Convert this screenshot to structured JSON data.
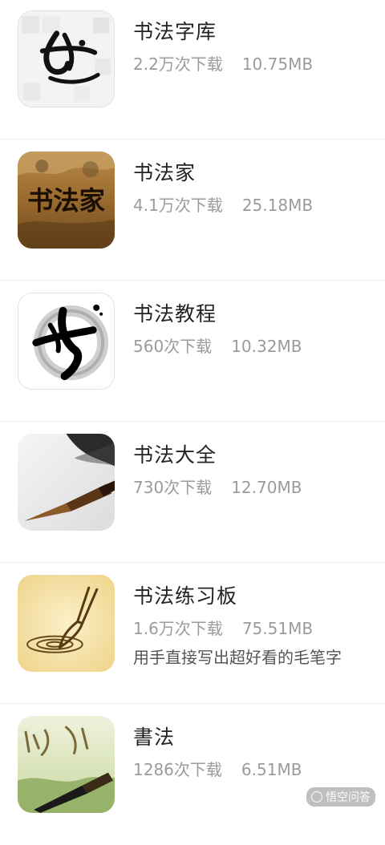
{
  "apps": [
    {
      "name": "书法字库",
      "downloads": "2.2万次下载",
      "size": "10.75MB",
      "icon": "calligraphy-font-library-icon"
    },
    {
      "name": "书法家",
      "downloads": "4.1万次下载",
      "size": "25.18MB",
      "icon": "calligrapher-painting-icon",
      "icon_text": "书法家"
    },
    {
      "name": "书法教程",
      "downloads": "560次下载",
      "size": "10.32MB",
      "icon": "calligraphy-tutorial-icon"
    },
    {
      "name": "书法大全",
      "downloads": "730次下载",
      "size": "12.70MB",
      "icon": "brush-on-paper-icon"
    },
    {
      "name": "书法练习板",
      "downloads": "1.6万次下载",
      "size": "75.51MB",
      "description": "用手直接写出超好看的毛笔字",
      "icon": "brush-practice-board-icon"
    },
    {
      "name": "書法",
      "downloads": "1286次下载",
      "size": "6.51MB",
      "icon": "brush-landscape-icon"
    }
  ],
  "watermark": {
    "text": "悟空问答"
  }
}
